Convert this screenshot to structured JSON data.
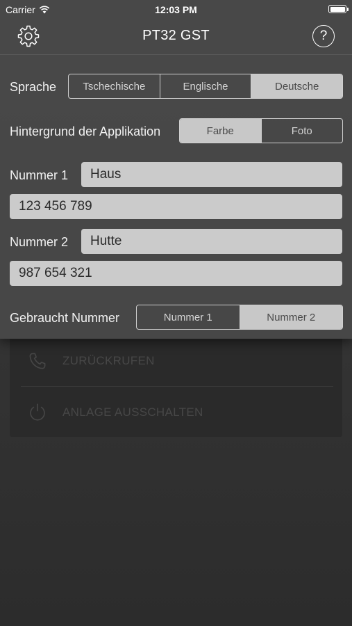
{
  "status_bar": {
    "carrier": "Carrier",
    "time": "12:03 PM"
  },
  "nav": {
    "title": "PT32 GST",
    "left_icon": "gear-icon",
    "right_icon": "help-icon",
    "help_glyph": "?"
  },
  "settings": {
    "language": {
      "label": "Sprache",
      "options": [
        "Tschechische",
        "Englische",
        "Deutsche"
      ],
      "selected": "Deutsche"
    },
    "background": {
      "label": "Hintergrund der Applikation",
      "options": [
        "Farbe",
        "Foto"
      ],
      "selected": "Farbe"
    },
    "number1": {
      "label": "Nummer 1",
      "name_value": "Haus",
      "phone_value": "123 456 789"
    },
    "number2": {
      "label": "Nummer 2",
      "name_value": "Hutte",
      "phone_value": "987 654 321"
    },
    "used_number": {
      "label": "Gebraucht Nummer",
      "options": [
        "Nummer 1",
        "Nummer 2"
      ],
      "selected": "Nummer 2"
    }
  },
  "background_screen": {
    "items": [
      {
        "label": "ZURÜCKRUFEN",
        "icon": "phone-icon"
      },
      {
        "label": "ANLAGE AUSSCHALTEN",
        "icon": "power-icon"
      }
    ]
  },
  "colors": {
    "panel": "#484848",
    "segment_active": "#c8c8c8",
    "field": "#cbcbcb",
    "page_background": "#363636"
  }
}
